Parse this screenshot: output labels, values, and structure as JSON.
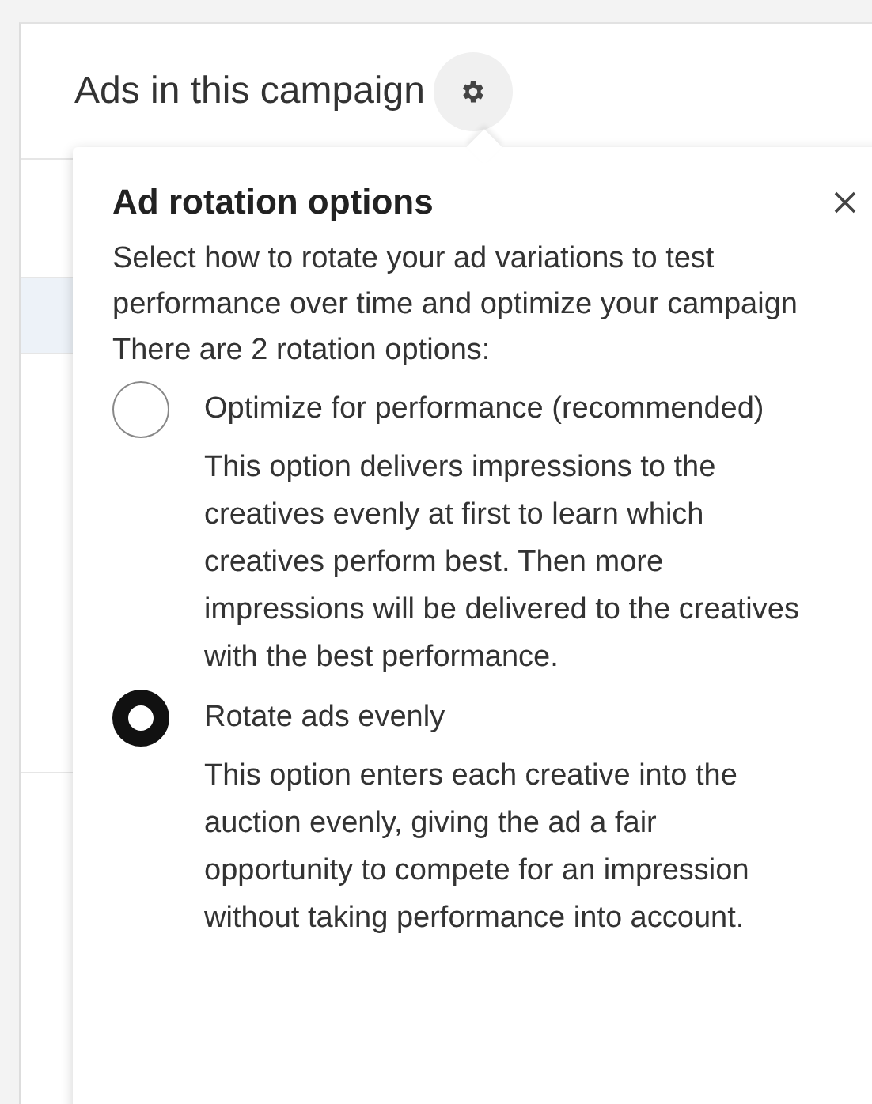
{
  "header": {
    "title": "Ads in this campaign"
  },
  "popover": {
    "title": "Ad rotation options",
    "description": "Select how to rotate your ad variations to test performance over time and optimize your campaign There are 2 rotation options:",
    "options": [
      {
        "label": "Optimize for performance (recommended)",
        "description": "This option delivers impressions to the creatives evenly at first to learn which creatives perform best. Then more impressions will be delivered to the creatives with the best performance.",
        "selected": false
      },
      {
        "label": "Rotate ads evenly",
        "description": "This option enters each creative into the auction evenly, giving the ad a fair opportunity to compete for an impression without taking performance into account.",
        "selected": true
      }
    ]
  }
}
